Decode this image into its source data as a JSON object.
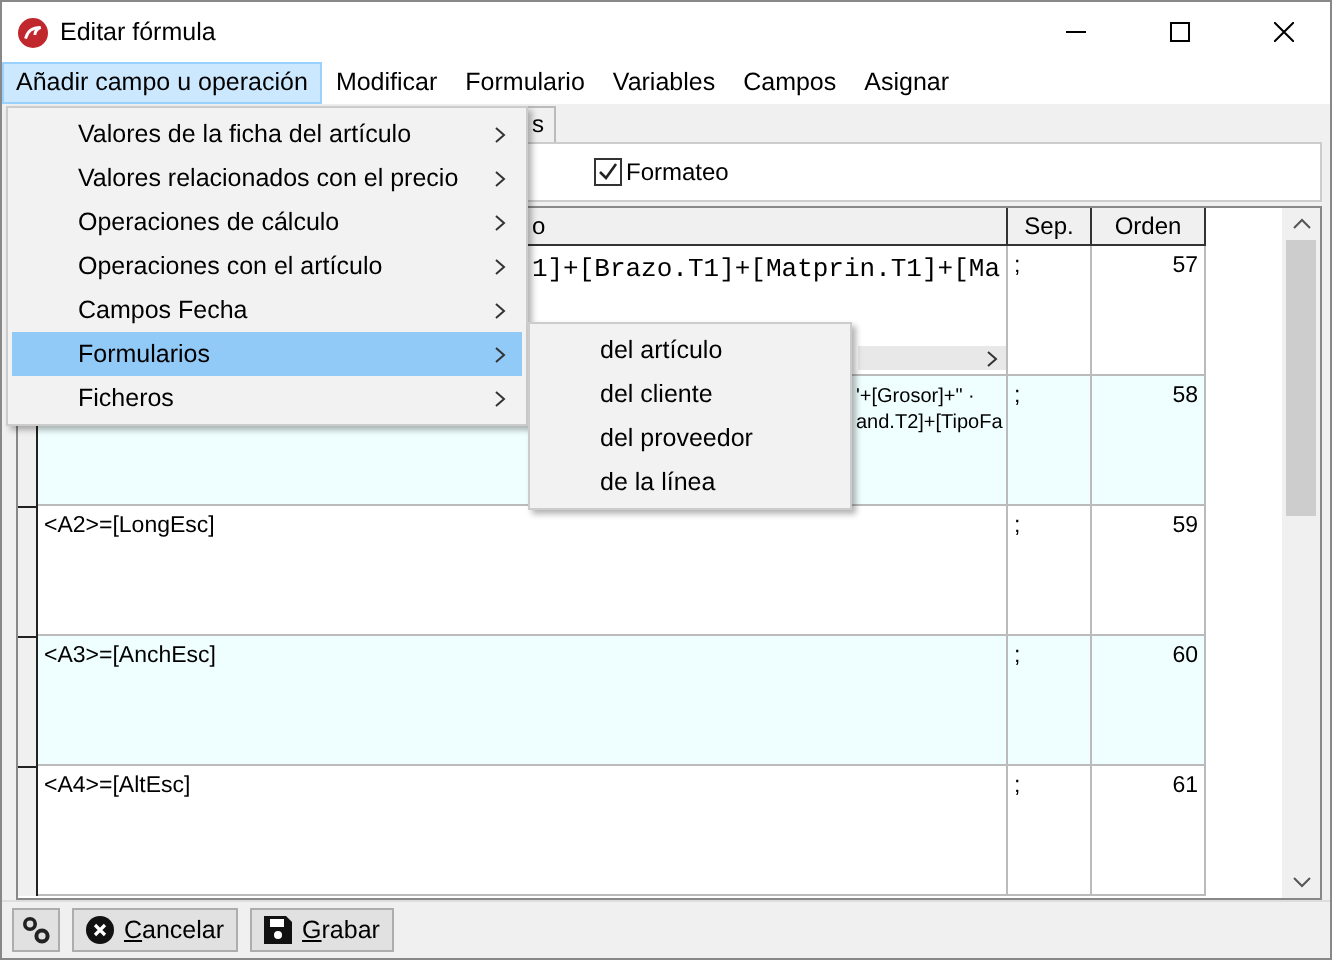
{
  "window": {
    "title": "Editar fórmula"
  },
  "menu_bar": [
    {
      "label": "Añadir campo u operación",
      "selected": true
    },
    {
      "label": "Modificar",
      "selected": false
    },
    {
      "label": "Formulario",
      "selected": false
    },
    {
      "label": "Variables",
      "selected": false
    },
    {
      "label": "Campos",
      "selected": false
    },
    {
      "label": "Asignar",
      "selected": false
    }
  ],
  "tab_strip": [
    {
      "label": "s"
    }
  ],
  "toolbar": {
    "formateo": {
      "label": "Formateo",
      "checked": true
    }
  },
  "grid": {
    "columns": [
      "o",
      "Sep.",
      "Orden"
    ],
    "rows": [
      {
        "kind": "mono",
        "formula": [
          "1]+[Brazo.T1]+[Matprin.T1]+[Ma"
        ],
        "sep": ";",
        "orden": "57"
      },
      {
        "kind": "sans",
        "formula": [
          "'+[Grosor]+\" ·",
          "and.T2]+[TipoFa"
        ],
        "sep": ";",
        "orden": "58"
      },
      {
        "kind": "plain",
        "formula": [
          "<A2>=[LongEsc]"
        ],
        "sep": ";",
        "orden": "59"
      },
      {
        "kind": "plain",
        "formula": [
          "<A3>=[AnchEsc]"
        ],
        "sep": ";",
        "orden": "60"
      },
      {
        "kind": "plain",
        "formula": [
          "<A4>=[AltEsc]"
        ],
        "sep": ";",
        "orden": "61"
      }
    ]
  },
  "dropdown_menu": {
    "items": [
      {
        "label": "Valores de la ficha del artículo",
        "selected": false
      },
      {
        "label": "Valores relacionados con el precio",
        "selected": false
      },
      {
        "label": "Operaciones de cálculo",
        "selected": false
      },
      {
        "label": "Operaciones con el artículo",
        "selected": false
      },
      {
        "label": "Campos Fecha",
        "selected": false
      },
      {
        "label": "Formularios",
        "selected": true
      },
      {
        "label": "Ficheros",
        "selected": false
      }
    ]
  },
  "submenu": {
    "items": [
      {
        "label": "del artículo"
      },
      {
        "label": "del cliente"
      },
      {
        "label": "del proveedor"
      },
      {
        "label": "de la línea"
      }
    ]
  },
  "buttons": [
    {
      "kind": "settings"
    },
    {
      "kind": "cancel",
      "label": "Cancelar"
    },
    {
      "kind": "save",
      "label": "Grabar"
    }
  ]
}
